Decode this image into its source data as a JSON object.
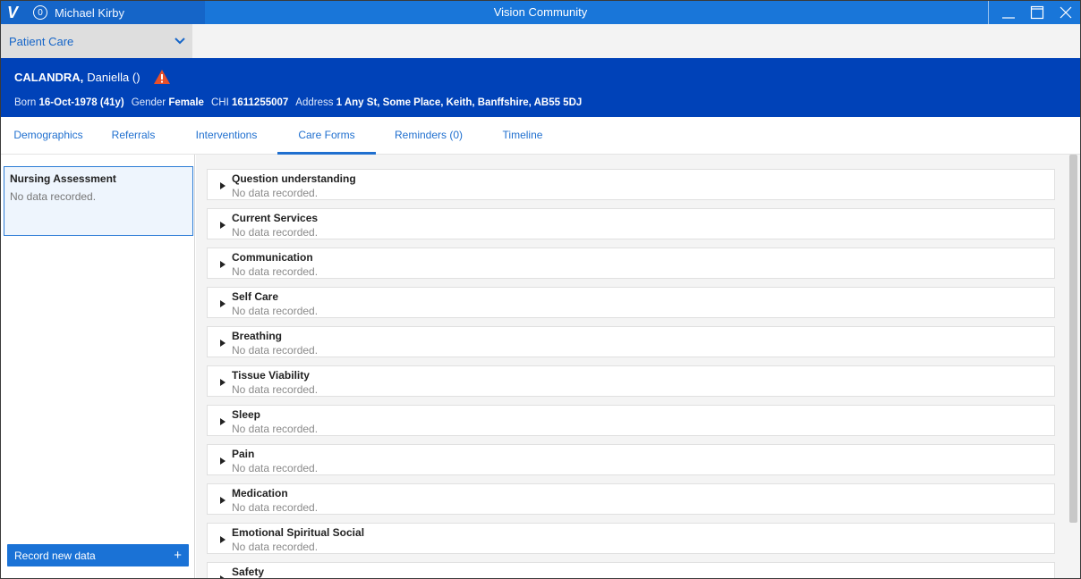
{
  "window": {
    "app_title": "Vision Community",
    "logo_text": "V",
    "user_badge": "0",
    "user_name": "Michael Kirby",
    "controls": {
      "minimize": "—",
      "maximize": "☐",
      "close": "✕"
    },
    "accent_color": "#1976d9"
  },
  "module_selector": {
    "selected": "Patient Care"
  },
  "patient": {
    "surname": "CALANDRA,",
    "forename": "Daniella ()",
    "born_label": "Born",
    "born_value": "16-Oct-1978 (41y)",
    "gender_label": "Gender",
    "gender_value": "Female",
    "chi_label": "CHI",
    "chi_value": "1611255007",
    "address_label": "Address",
    "address_value": "1 Any St, Some Place, Keith, Banffshire, AB55 5DJ"
  },
  "tabs": [
    {
      "label": "Demographics"
    },
    {
      "label": "Referrals"
    },
    {
      "label": "Interventions"
    },
    {
      "label": "Care Forms"
    },
    {
      "label": "Reminders (0)"
    },
    {
      "label": "Timeline"
    }
  ],
  "active_tab": "Care Forms",
  "left_panel": {
    "form_title": "Nursing Assessment",
    "form_status": "No data recorded.",
    "record_button": "Record new data",
    "record_button_icon": "+"
  },
  "sections": [
    {
      "title": "Question understanding",
      "status": "No data recorded."
    },
    {
      "title": "Current Services",
      "status": "No data recorded."
    },
    {
      "title": "Communication",
      "status": "No data recorded."
    },
    {
      "title": "Self Care",
      "status": "No data recorded."
    },
    {
      "title": "Breathing",
      "status": "No data recorded."
    },
    {
      "title": "Tissue Viability",
      "status": "No data recorded."
    },
    {
      "title": "Sleep",
      "status": "No data recorded."
    },
    {
      "title": "Pain",
      "status": "No data recorded."
    },
    {
      "title": "Medication",
      "status": "No data recorded."
    },
    {
      "title": "Emotional Spiritual Social",
      "status": "No data recorded."
    },
    {
      "title": "Safety",
      "status": ""
    }
  ]
}
